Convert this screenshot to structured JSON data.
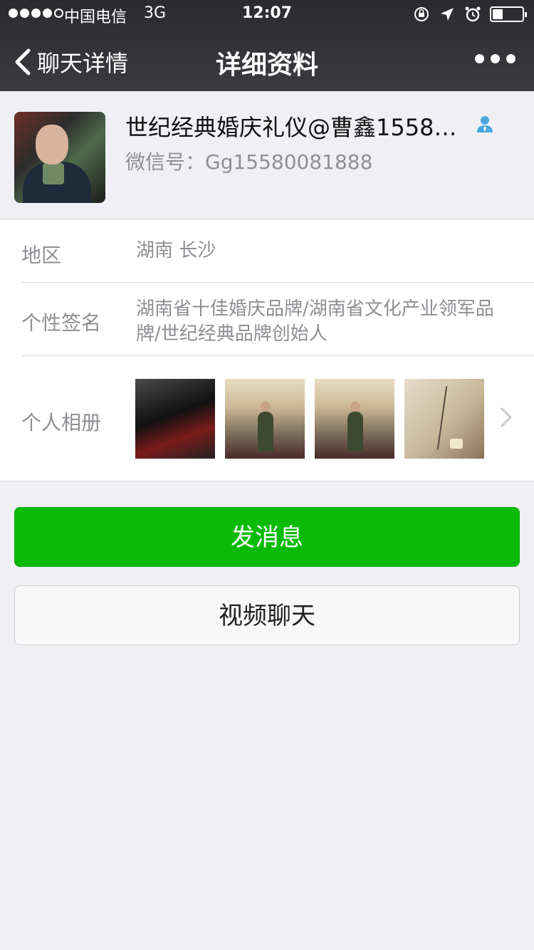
{
  "status_bar": {
    "carrier": "中国电信",
    "network": "3G",
    "time": "12:07",
    "signal_bars_filled": 4,
    "signal_bars_total": 5,
    "battery_level": 0.35
  },
  "nav": {
    "back_label": "聊天详情",
    "title": "详细资料",
    "icons": [
      "chevron-left-icon",
      "more-icon"
    ]
  },
  "profile": {
    "name": "世纪经典婚庆礼仪@曹鑫15580…",
    "wechat_id": "微信号：Gg15580081888",
    "badge_icon": "person-icon"
  },
  "info": {
    "region_label": "地区",
    "region_value": "湖南 长沙",
    "signature_label": "个性签名",
    "signature_value": "湖南省十佳婚庆品牌/湖南省文化产业领军品牌/世纪经典品牌创始人",
    "album_label": "个人相册",
    "album_photo_count": 4
  },
  "actions": {
    "send_message": "发消息",
    "video_chat": "视频聊天"
  },
  "colors": {
    "nav_bg": "#2b2b2f",
    "page_bg": "#efeff4",
    "primary_green": "#09bb07",
    "badge_blue": "#4aa7de"
  }
}
